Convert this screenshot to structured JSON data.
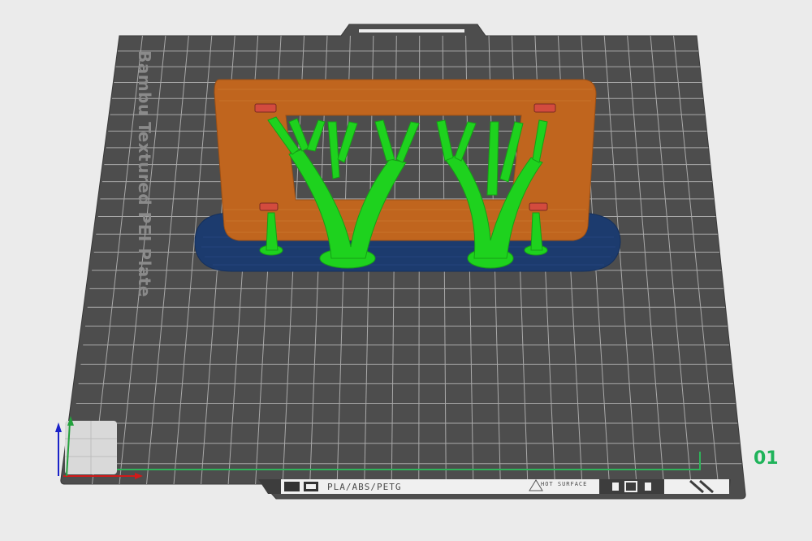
{
  "plate": {
    "label": "Bambu Textured PEI Plate",
    "number": "01",
    "material_label": "PLA/ABS/PETG",
    "surface_label": "HOT SURFACE",
    "plate_color": "#4d4d4d",
    "grid_color": "#a9a9a9"
  },
  "model": {
    "frame_color": "#c0651e",
    "support_color": "#1ed21e",
    "brim_color": "#1c3b6e",
    "tip_color": "#d34b3e"
  },
  "axes": {
    "x_color": "#d11a1a",
    "y_color": "#23a23d",
    "z_color": "#1a22c8"
  },
  "icons": [
    "plate-grid-icon",
    "plate-type-icon",
    "hot-surface-warning-icon",
    "plate-edit-icon"
  ]
}
